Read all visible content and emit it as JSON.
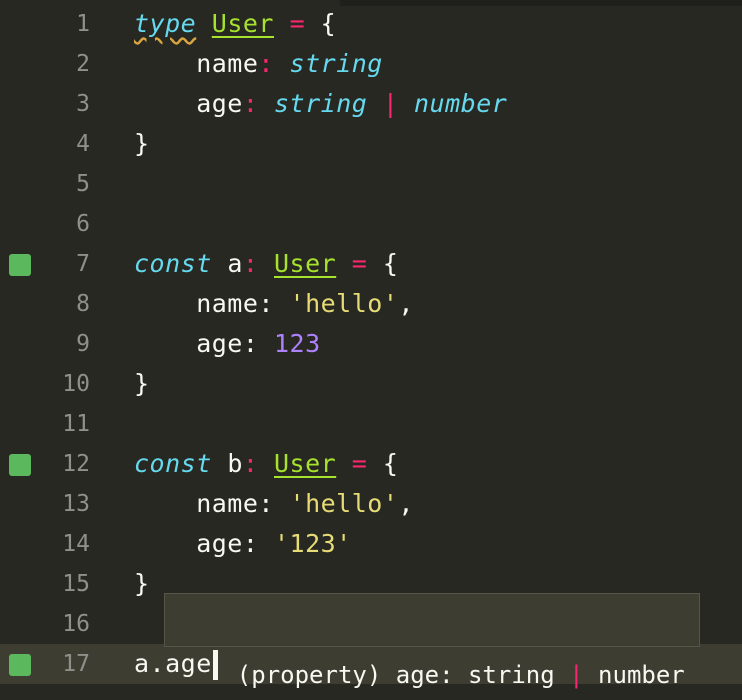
{
  "editor": {
    "lines": [
      {
        "n": "1",
        "segments": [
          {
            "t": "type",
            "cls": "kw squiggle"
          },
          {
            "t": " ",
            "cls": ""
          },
          {
            "t": "User",
            "cls": "type-ref"
          },
          {
            "t": " ",
            "cls": ""
          },
          {
            "t": "=",
            "cls": "op"
          },
          {
            "t": " {",
            "cls": ""
          }
        ]
      },
      {
        "n": "2",
        "segments": [
          {
            "t": "    name",
            "cls": ""
          },
          {
            "t": ":",
            "cls": "op"
          },
          {
            "t": " ",
            "cls": ""
          },
          {
            "t": "string",
            "cls": "type-name"
          }
        ]
      },
      {
        "n": "3",
        "segments": [
          {
            "t": "    age",
            "cls": ""
          },
          {
            "t": ":",
            "cls": "op"
          },
          {
            "t": " ",
            "cls": ""
          },
          {
            "t": "string",
            "cls": "type-name"
          },
          {
            "t": " ",
            "cls": ""
          },
          {
            "t": "|",
            "cls": "op"
          },
          {
            "t": " ",
            "cls": ""
          },
          {
            "t": "number",
            "cls": "type-name"
          }
        ]
      },
      {
        "n": "4",
        "segments": [
          {
            "t": "}",
            "cls": ""
          }
        ]
      },
      {
        "n": "5",
        "segments": []
      },
      {
        "n": "6",
        "segments": []
      },
      {
        "n": "7",
        "marker": true,
        "segments": [
          {
            "t": "const",
            "cls": "kw"
          },
          {
            "t": " a",
            "cls": ""
          },
          {
            "t": ":",
            "cls": "op"
          },
          {
            "t": " ",
            "cls": ""
          },
          {
            "t": "User",
            "cls": "type-ref"
          },
          {
            "t": " ",
            "cls": ""
          },
          {
            "t": "=",
            "cls": "op"
          },
          {
            "t": " {",
            "cls": ""
          }
        ]
      },
      {
        "n": "8",
        "segments": [
          {
            "t": "    name: ",
            "cls": ""
          },
          {
            "t": "'hello'",
            "cls": "str"
          },
          {
            "t": ",",
            "cls": ""
          }
        ]
      },
      {
        "n": "9",
        "segments": [
          {
            "t": "    age: ",
            "cls": ""
          },
          {
            "t": "123",
            "cls": "num"
          }
        ]
      },
      {
        "n": "10",
        "segments": [
          {
            "t": "}",
            "cls": ""
          }
        ]
      },
      {
        "n": "11",
        "segments": []
      },
      {
        "n": "12",
        "marker": true,
        "segments": [
          {
            "t": "const",
            "cls": "kw"
          },
          {
            "t": " b",
            "cls": ""
          },
          {
            "t": ":",
            "cls": "op"
          },
          {
            "t": " ",
            "cls": ""
          },
          {
            "t": "User",
            "cls": "type-ref"
          },
          {
            "t": " ",
            "cls": ""
          },
          {
            "t": "=",
            "cls": "op"
          },
          {
            "t": " {",
            "cls": ""
          }
        ]
      },
      {
        "n": "13",
        "segments": [
          {
            "t": "    name: ",
            "cls": ""
          },
          {
            "t": "'hello'",
            "cls": "str"
          },
          {
            "t": ",",
            "cls": ""
          }
        ]
      },
      {
        "n": "14",
        "segments": [
          {
            "t": "    age: ",
            "cls": ""
          },
          {
            "t": "'123'",
            "cls": "str"
          }
        ]
      },
      {
        "n": "15",
        "segments": [
          {
            "t": "}",
            "cls": ""
          }
        ]
      },
      {
        "n": "16",
        "segments": []
      },
      {
        "n": "17",
        "marker": true,
        "active": true,
        "cursor": true,
        "segments": [
          {
            "t": "a.age",
            "cls": ""
          }
        ]
      }
    ]
  },
  "tooltip": {
    "prefix": "(property) age: string ",
    "union_op": "|",
    "suffix": " number"
  },
  "colors": {
    "background": "#272822",
    "keyword": "#66d9ef",
    "type_reference": "#a6e22e",
    "operator": "#f92672",
    "string": "#e6db74",
    "number": "#ae81ff",
    "gutter_marker": "#5cb85c"
  }
}
